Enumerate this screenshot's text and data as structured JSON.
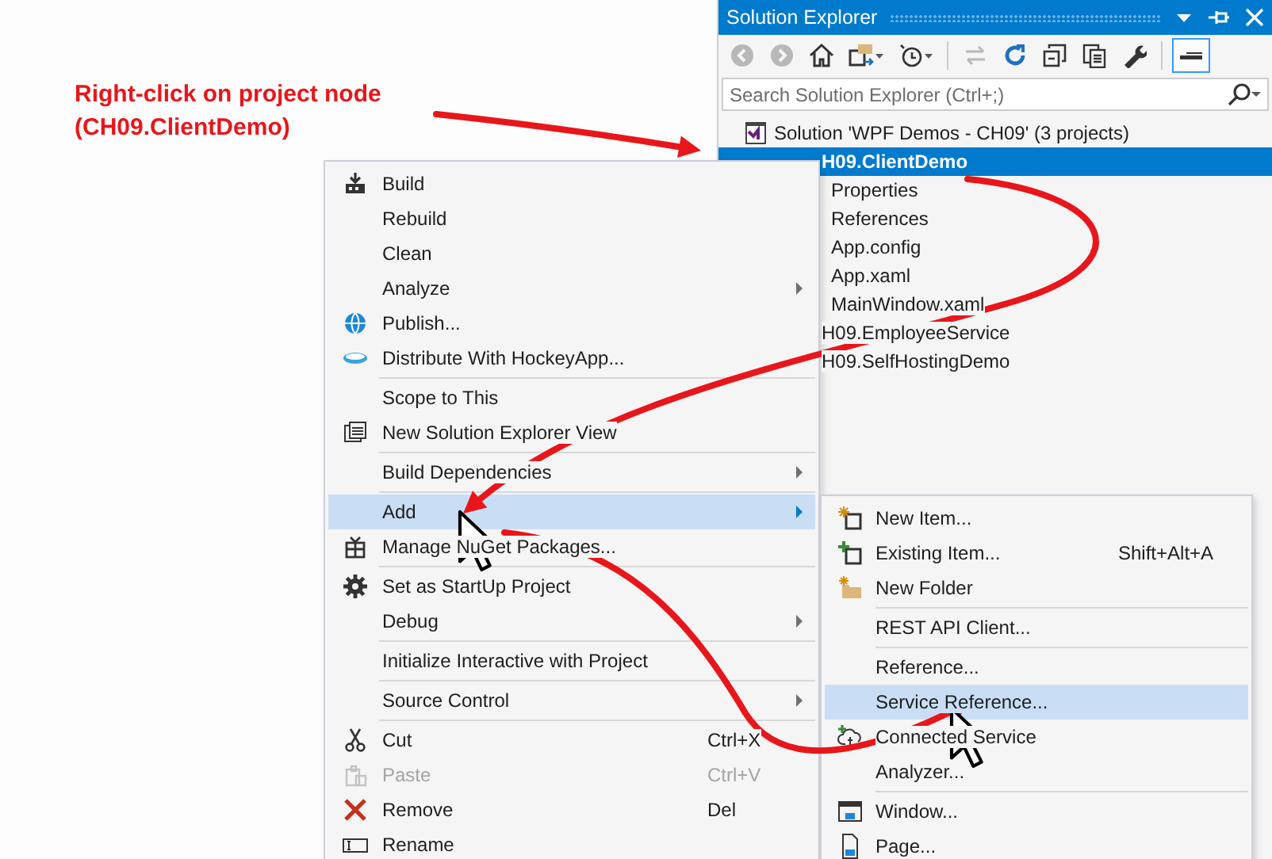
{
  "annotation": {
    "lines": [
      "Right-click on project node",
      "(CH09.ClientDemo)"
    ]
  },
  "solution_explorer": {
    "title": "Solution Explorer",
    "toolbar": [
      {
        "disabled": true,
        "dropdown": false,
        "selected": false
      },
      {
        "disabled": true,
        "dropdown": false,
        "selected": false
      },
      {
        "disabled": false,
        "dropdown": false,
        "selected": false
      },
      {
        "disabled": false,
        "dropdown": true,
        "selected": false
      },
      {
        "disabled": false,
        "dropdown": true,
        "selected": false
      },
      {
        "disabled": true,
        "dropdown": false,
        "selected": false
      },
      {
        "disabled": false,
        "dropdown": false,
        "selected": false
      },
      {
        "disabled": false,
        "dropdown": false,
        "selected": false
      },
      {
        "disabled": false,
        "dropdown": false,
        "selected": false
      },
      {
        "disabled": false,
        "dropdown": false,
        "selected": false
      },
      {
        "disabled": false,
        "dropdown": false,
        "selected": true
      }
    ],
    "search": {
      "placeholder": "Search Solution Explorer (Ctrl+;)"
    },
    "tree": [
      {
        "label": "Solution 'WPF Demos - CH09' (3 projects)",
        "selected": false,
        "children": [
          {
            "label": "H09.ClientDemo",
            "selected": true,
            "children": [
              {
                "label": "Properties",
                "selected": false
              },
              {
                "label": "References",
                "selected": false
              },
              {
                "label": "App.config",
                "selected": false
              },
              {
                "label": "App.xaml",
                "selected": false
              },
              {
                "label": "MainWindow.xaml",
                "selected": false
              }
            ]
          },
          {
            "label": "H09.EmployeeService",
            "selected": false
          },
          {
            "label": "H09.SelfHostingDemo",
            "selected": false
          }
        ]
      }
    ]
  },
  "context_menu": [
    {
      "kind": "item",
      "label": "Build",
      "selected": false,
      "disabled": false,
      "submenu": false
    },
    {
      "kind": "item",
      "label": "Rebuild",
      "selected": false,
      "disabled": false,
      "submenu": false
    },
    {
      "kind": "item",
      "label": "Clean",
      "selected": false,
      "disabled": false,
      "submenu": false
    },
    {
      "kind": "item",
      "label": "Analyze",
      "selected": false,
      "disabled": false,
      "submenu": true
    },
    {
      "kind": "item",
      "label": "Publish...",
      "selected": false,
      "disabled": false,
      "submenu": false
    },
    {
      "kind": "item",
      "label": "Distribute With HockeyApp...",
      "selected": false,
      "disabled": false,
      "submenu": false
    },
    {
      "kind": "separator"
    },
    {
      "kind": "item",
      "label": "Scope to This",
      "selected": false,
      "disabled": false,
      "submenu": false
    },
    {
      "kind": "item",
      "label": "New Solution Explorer View",
      "selected": false,
      "disabled": false,
      "submenu": false
    },
    {
      "kind": "separator"
    },
    {
      "kind": "item",
      "label": "Build Dependencies",
      "selected": false,
      "disabled": false,
      "submenu": true
    },
    {
      "kind": "separator"
    },
    {
      "kind": "item",
      "label": "Add",
      "selected": true,
      "disabled": false,
      "submenu": true
    },
    {
      "kind": "item",
      "label": "Manage NuGet Packages...",
      "selected": false,
      "disabled": false,
      "submenu": false
    },
    {
      "kind": "separator"
    },
    {
      "kind": "item",
      "label": "Set as StartUp Project",
      "selected": false,
      "disabled": false,
      "submenu": false
    },
    {
      "kind": "item",
      "label": "Debug",
      "selected": false,
      "disabled": false,
      "submenu": true
    },
    {
      "kind": "separator"
    },
    {
      "kind": "item",
      "label": "Initialize Interactive with Project",
      "selected": false,
      "disabled": false,
      "submenu": false
    },
    {
      "kind": "separator"
    },
    {
      "kind": "item",
      "label": "Source Control",
      "selected": false,
      "disabled": false,
      "submenu": true
    },
    {
      "kind": "separator"
    },
    {
      "kind": "item",
      "label": "Cut",
      "shortcut": "Ctrl+X",
      "selected": false,
      "disabled": false,
      "submenu": false
    },
    {
      "kind": "item",
      "label": "Paste",
      "shortcut": "Ctrl+V",
      "selected": false,
      "disabled": true,
      "submenu": false
    },
    {
      "kind": "item",
      "label": "Remove",
      "shortcut": "Del",
      "selected": false,
      "disabled": false,
      "submenu": false
    },
    {
      "kind": "item",
      "label": "Rename",
      "selected": false,
      "disabled": false,
      "submenu": false
    }
  ],
  "add_submenu": [
    {
      "kind": "item",
      "label": "New Item...",
      "selected": false,
      "disabled": false,
      "submenu": false
    },
    {
      "kind": "item",
      "label": "Existing Item...",
      "shortcut": "Shift+Alt+A",
      "selected": false,
      "disabled": false,
      "submenu": false
    },
    {
      "kind": "item",
      "label": "New Folder",
      "selected": false,
      "disabled": false,
      "submenu": false
    },
    {
      "kind": "separator"
    },
    {
      "kind": "item",
      "label": "REST API Client...",
      "selected": false,
      "disabled": false,
      "submenu": false
    },
    {
      "kind": "separator"
    },
    {
      "kind": "item",
      "label": "Reference...",
      "selected": false,
      "disabled": false,
      "submenu": false
    },
    {
      "kind": "item",
      "label": "Service Reference...",
      "selected": true,
      "disabled": false,
      "submenu": false
    },
    {
      "kind": "item",
      "label": "Connected Service",
      "selected": false,
      "disabled": false,
      "submenu": false
    },
    {
      "kind": "item",
      "label": "Analyzer...",
      "selected": false,
      "disabled": false,
      "submenu": false
    },
    {
      "kind": "separator"
    },
    {
      "kind": "item",
      "label": "Window...",
      "selected": false,
      "disabled": false,
      "submenu": false
    },
    {
      "kind": "item",
      "label": "Page...",
      "selected": false,
      "disabled": false,
      "submenu": false
    }
  ]
}
